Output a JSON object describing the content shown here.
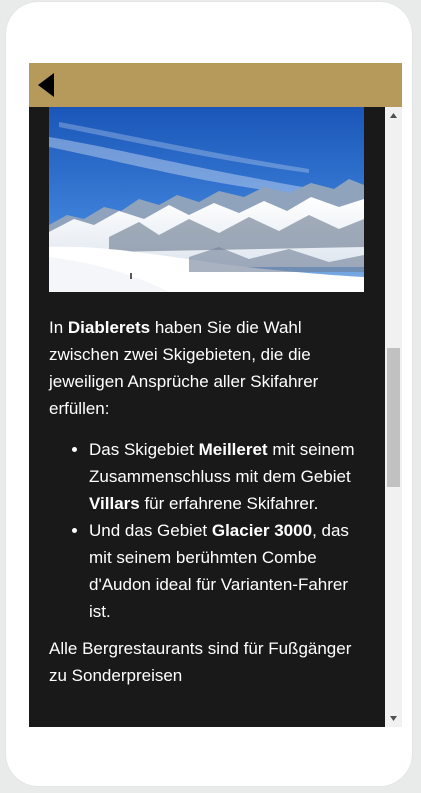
{
  "header": {
    "back_icon": "back-arrow-icon",
    "accent_color": "#b59a5c"
  },
  "hero_image": {
    "subject": "snowy-mountain-landscape"
  },
  "article": {
    "intro_prefix": "In ",
    "intro_bold": "Diablerets",
    "intro_suffix": " haben Sie die Wahl zwischen zwei Skigebieten, die die jeweiligen Ansprüche aller Skifahrer erfüllen:",
    "bullets": [
      {
        "t1": "Das Skigebiet ",
        "b1": "Meilleret",
        "t2": " mit seinem Zusammenschluss mit dem Gebiet ",
        "b2": "Villars",
        "t3": " für erfahrene Skifahrer."
      },
      {
        "t1": "Und das Gebiet ",
        "b1": "Glacier 3000",
        "t2": ", das mit seinem berühmten Combe d'Audon ideal für Varianten-Fahrer ist."
      }
    ],
    "closing": "Alle Bergrestaurants sind für Fußgänger zu Sonderpreisen"
  },
  "scrollbar": {
    "up_icon": "scroll-up-arrow-icon",
    "down_icon": "scroll-down-arrow-icon"
  }
}
